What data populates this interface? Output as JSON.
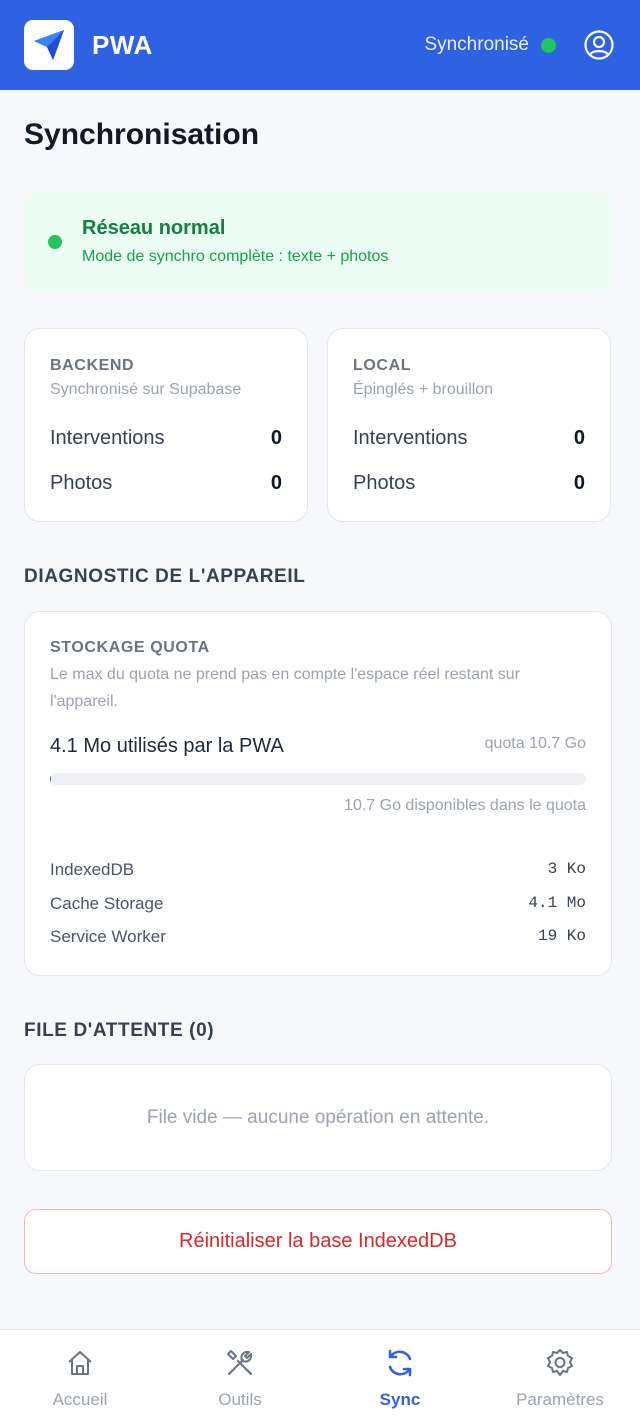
{
  "header": {
    "app_title": "PWA",
    "sync_status": "Synchronisé",
    "status_color": "#22c55e",
    "brand_color": "#2f62e3",
    "logo_icon": "paper-plane-icon",
    "profile_icon": "user-circle-icon"
  },
  "page": {
    "title": "Synchronisation"
  },
  "network": {
    "title": "Réseau normal",
    "subtitle": "Mode de synchro complète : texte + photos"
  },
  "backend": {
    "label": "BACKEND",
    "subtitle": "Synchronisé sur Supabase",
    "rows": [
      {
        "label": "Interventions",
        "value": "0"
      },
      {
        "label": "Photos",
        "value": "0"
      }
    ]
  },
  "local": {
    "label": "LOCAL",
    "subtitle": "Épinglés + brouillon",
    "rows": [
      {
        "label": "Interventions",
        "value": "0"
      },
      {
        "label": "Photos",
        "value": "0"
      }
    ]
  },
  "diagnostic": {
    "section_title": "DIAGNOSTIC DE L'APPAREIL",
    "card_label": "STOCKAGE QUOTA",
    "description": "Le max du quota ne prend pas en compte l'espace réel restant sur l'appareil.",
    "used": "4.1 Mo utilisés par la PWA",
    "quota": "quota 10.7 Go",
    "usage_fraction": 0.0004,
    "available": "10.7 Go disponibles dans le quota",
    "storage": [
      {
        "label": "IndexedDB",
        "value": "3 Ko"
      },
      {
        "label": "Cache Storage",
        "value": "4.1 Mo"
      },
      {
        "label": "Service Worker",
        "value": "19 Ko"
      }
    ]
  },
  "queue": {
    "section_title": "FILE D'ATTENTE (0)",
    "empty_text": "File vide — aucune opération en attente."
  },
  "reset": {
    "label": "Réinitialiser la base IndexedDB"
  },
  "nav": {
    "items": [
      {
        "label": "Accueil",
        "icon": "home-icon",
        "active": false
      },
      {
        "label": "Outils",
        "icon": "tools-icon",
        "active": false
      },
      {
        "label": "Sync",
        "icon": "sync-icon",
        "active": true
      },
      {
        "label": "Paramètres",
        "icon": "gear-icon",
        "active": false
      }
    ]
  }
}
